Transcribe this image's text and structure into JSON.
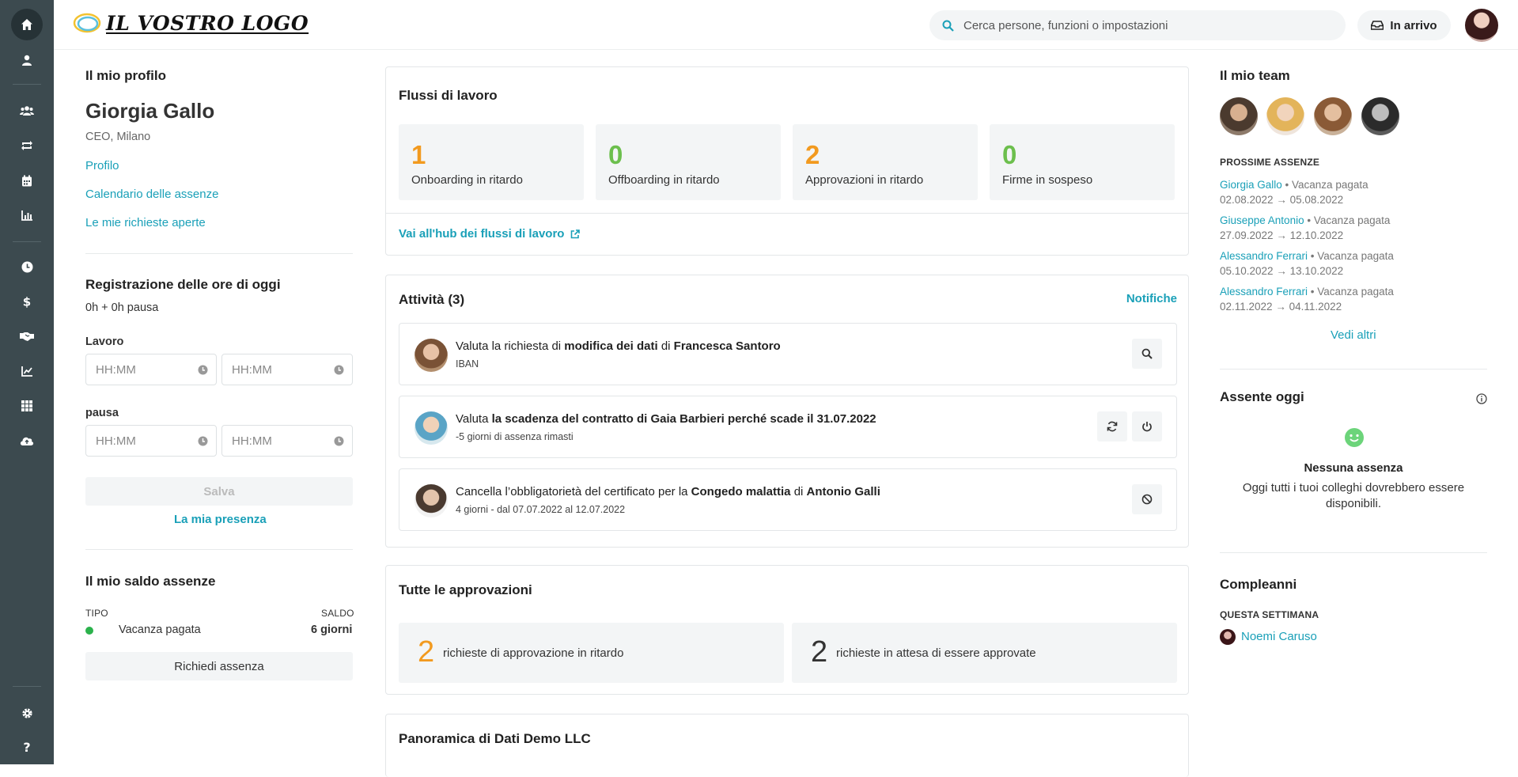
{
  "header": {
    "logo_text": "IL VOSTRO LOGO",
    "search_placeholder": "Cerca persone, funzioni o impostazioni",
    "inbox_label": "In arrivo"
  },
  "profile": {
    "section_title": "Il mio profilo",
    "name": "Giorgia Gallo",
    "role": "CEO, Milano",
    "links": [
      "Profilo",
      "Calendario delle assenze",
      "Le mie richieste aperte"
    ]
  },
  "time_tracking": {
    "title": "Registrazione delle ore di oggi",
    "summary": "0h + 0h pausa",
    "work_label": "Lavoro",
    "break_label": "pausa",
    "placeholder": "HH:MM",
    "save_label": "Salva",
    "attendance_link": "La mia presenza"
  },
  "balance": {
    "title": "Il mio saldo assenze",
    "col_type": "TIPO",
    "col_balance": "SALDO",
    "rows": [
      {
        "type": "Vacanza pagata",
        "balance": "6 giorni",
        "color": "#2bb24c"
      }
    ],
    "request_label": "Richiedi assenza"
  },
  "workflows": {
    "title": "Flussi di lavoro",
    "stats": [
      {
        "value": "1",
        "label": "Onboarding in ritardo",
        "color": "#f29a1f"
      },
      {
        "value": "0",
        "label": "Offboarding in ritardo",
        "color": "#6cbf4d"
      },
      {
        "value": "2",
        "label": "Approvazioni in ritardo",
        "color": "#f29a1f"
      },
      {
        "value": "0",
        "label": "Firme in sospeso",
        "color": "#6cbf4d"
      }
    ],
    "hub_link": "Vai all'hub dei flussi di lavoro"
  },
  "activities": {
    "title": "Attività (3)",
    "notifications_link": "Notifiche",
    "items": [
      {
        "pre": "Valuta la richiesta di ",
        "b1": "modifica dei dati",
        "mid": " di ",
        "b2": "Francesca Santoro",
        "sub": "IBAN"
      },
      {
        "pre": "Valuta ",
        "b1": "la scadenza del contratto di Gaia Barbieri perché scade il 31.07.2022",
        "mid": "",
        "b2": "",
        "sub": "-5 giorni di assenza rimasti"
      },
      {
        "pre": "Cancella l’obbligatorietà del certificato per la ",
        "b1": "Congedo malattia",
        "mid": " di ",
        "b2": "Antonio Galli",
        "sub": "4 giorni - dal 07.07.2022 al 12.07.2022"
      }
    ]
  },
  "approvals": {
    "title": "Tutte le approvazioni",
    "items": [
      {
        "value": "2",
        "label": "richieste di approvazione in ritardo",
        "color": "#f29a1f"
      },
      {
        "value": "2",
        "label": "richieste in attesa di essere approvate",
        "color": "#333333"
      }
    ]
  },
  "overview": {
    "title": "Panoramica di Dati Demo LLC"
  },
  "team": {
    "title": "Il mio team",
    "upcoming_title": "PROSSIME ASSENZE",
    "absences": [
      {
        "name": "Giorgia Gallo",
        "type": "Vacanza pagata",
        "dates": "02.08.2022 → 05.08.2022"
      },
      {
        "name": "Giuseppe Antonio",
        "type": "Vacanza pagata",
        "dates": "27.09.2022 → 12.10.2022"
      },
      {
        "name": "Alessandro Ferrari",
        "type": "Vacanza pagata",
        "dates": "05.10.2022 → 13.10.2022"
      },
      {
        "name": "Alessandro Ferrari",
        "type": "Vacanza pagata",
        "dates": "02.11.2022 → 04.11.2022"
      }
    ],
    "see_more": "Vedi altri"
  },
  "absent_today": {
    "title": "Assente oggi",
    "empty_title": "Nessuna assenza",
    "empty_text": "Oggi tutti i tuoi colleghi dovrebbero essere disponibili."
  },
  "birthdays": {
    "title": "Compleanni",
    "week_title": "QUESTA SETTIMANA",
    "people": [
      "Noemi Caruso"
    ]
  },
  "colors": {
    "accent": "#1aa0b8",
    "sidebar": "#3c4a4f",
    "orange": "#f29a1f",
    "green": "#6cbf4d"
  }
}
